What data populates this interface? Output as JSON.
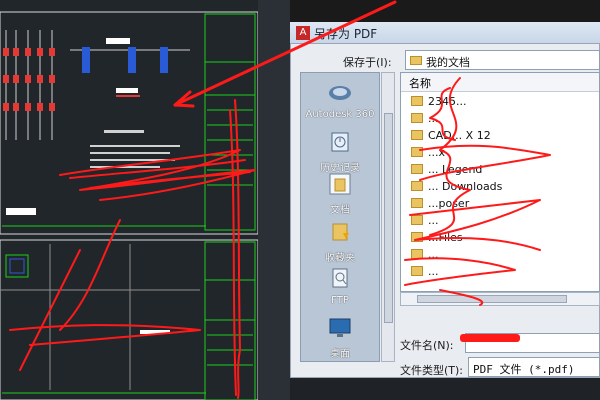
{
  "dialog": {
    "title": "另存为 PDF",
    "app_icon_letter": "A",
    "save_in_label": "保存于(I):",
    "save_in_value": "我的文档",
    "places": [
      {
        "label": "Autodesk 360",
        "icon": "cloud-icon"
      },
      {
        "label": "历史记录",
        "icon": "history-icon"
      },
      {
        "label": "文档",
        "icon": "documents-icon"
      },
      {
        "label": "收藏夹",
        "icon": "favorites-icon"
      },
      {
        "label": "FTP",
        "icon": "ftp-icon"
      },
      {
        "label": "桌面",
        "icon": "desktop-icon"
      }
    ],
    "list_header": "名称",
    "files": [
      "2345...",
      "...",
      "CAD... X 12",
      "...x",
      "... Legend",
      "... Downloads",
      "...poser",
      "...",
      "...Files",
      "...",
      "...",
      "..."
    ],
    "filename_label": "文件名(N):",
    "filename_value": "",
    "filetype_label": "文件类型(T):",
    "filetype_value": "PDF 文件 (*.pdf)"
  },
  "colors": {
    "cad_bg": "#21262b",
    "cad_green": "#1bd01b",
    "scribble_red": "#ff1a1a",
    "dialog_bg": "#e9ecf1"
  }
}
